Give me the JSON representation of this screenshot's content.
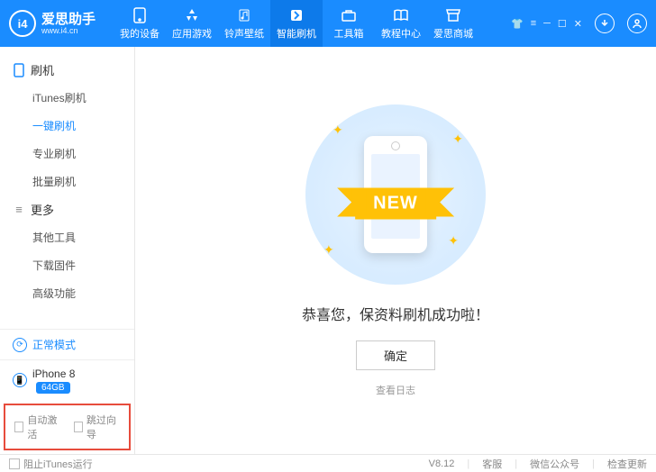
{
  "brand": {
    "name": "爱思助手",
    "url": "www.i4.cn",
    "logo_text": "i4"
  },
  "topnav": [
    {
      "label": "我的设备",
      "icon": "phone"
    },
    {
      "label": "应用游戏",
      "icon": "apps"
    },
    {
      "label": "铃声壁纸",
      "icon": "music"
    },
    {
      "label": "智能刷机",
      "icon": "flash",
      "active": true
    },
    {
      "label": "工具箱",
      "icon": "tools"
    },
    {
      "label": "教程中心",
      "icon": "book"
    },
    {
      "label": "爱思商城",
      "icon": "shop"
    }
  ],
  "sidebar": {
    "groups": [
      {
        "title": "刷机",
        "items": [
          "iTunes刷机",
          "一键刷机",
          "专业刷机",
          "批量刷机"
        ],
        "active_index": 1
      },
      {
        "title": "更多",
        "items": [
          "其他工具",
          "下载固件",
          "高级功能"
        ]
      }
    ],
    "mode": {
      "label": "正常模式"
    },
    "device": {
      "name": "iPhone 8",
      "storage": "64GB"
    },
    "options": [
      {
        "label": "自动激活"
      },
      {
        "label": "跳过向导"
      }
    ]
  },
  "main": {
    "ribbon": "NEW",
    "message": "恭喜您，保资料刷机成功啦！",
    "ok": "确定",
    "log": "查看日志"
  },
  "statusbar": {
    "block_itunes": "阻止iTunes运行",
    "version": "V8.12",
    "links": [
      "客服",
      "微信公众号",
      "检查更新"
    ]
  }
}
